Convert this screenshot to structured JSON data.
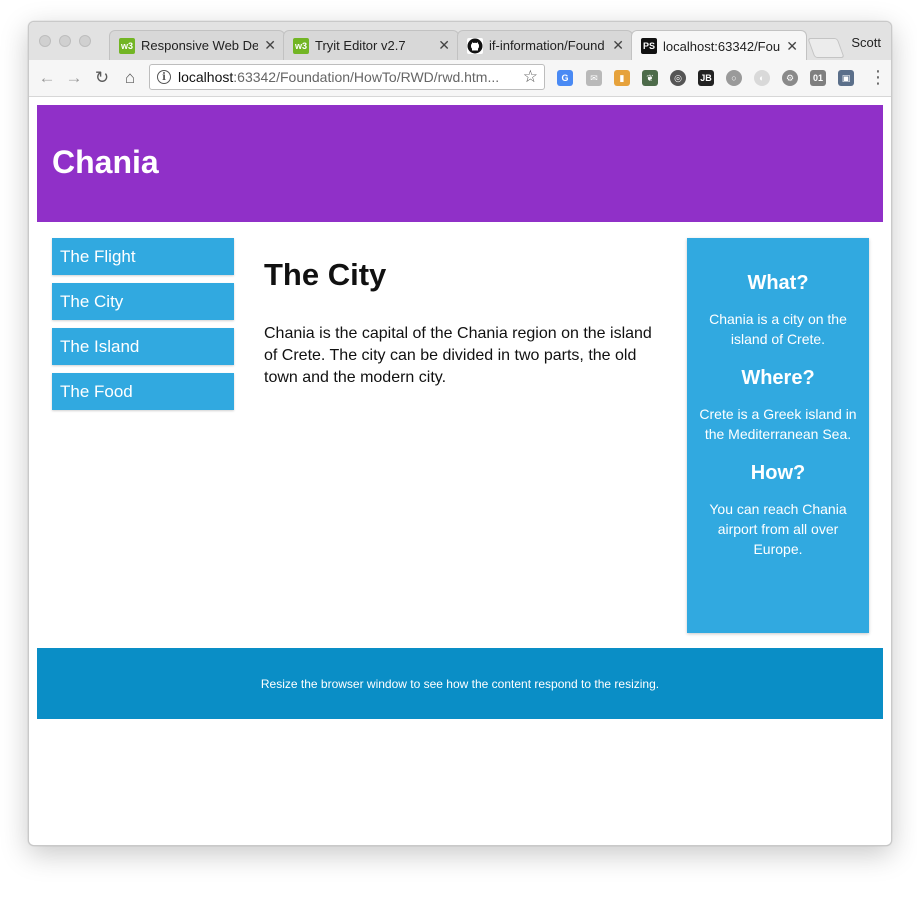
{
  "browser": {
    "tabs": [
      {
        "label": "Responsive Web Des",
        "favicon": "w3schools-icon"
      },
      {
        "label": "Tryit Editor v2.7",
        "favicon": "w3schools-icon"
      },
      {
        "label": "if-information/Found",
        "favicon": "github-icon"
      },
      {
        "label": "localhost:63342/Fou",
        "favicon": "phpstorm-icon"
      }
    ],
    "profile_name": "Scott",
    "url_host": "localhost",
    "url_path": ":63342/Foundation/HowTo/RWD/rwd.htm..."
  },
  "page": {
    "header_title": "Chania",
    "nav_items": [
      "The Flight",
      "The City",
      "The Island",
      "The Food"
    ],
    "main": {
      "title": "The City",
      "body": "Chania is the capital of the Chania region on the island of Crete. The city can be divided in two parts, the old town and the modern city."
    },
    "aside": [
      {
        "heading": "What?",
        "text": "Chania is a city on the island of Crete."
      },
      {
        "heading": "Where?",
        "text": "Crete is a Greek island in the Mediterranean Sea."
      },
      {
        "heading": "How?",
        "text": "You can reach Chania airport from all over Europe."
      }
    ],
    "footer_text": "Resize the browser window to see how the content respond to the resizing."
  },
  "colors": {
    "header_bg": "#9030c8",
    "nav_bg": "#31a9e0",
    "footer_bg": "#0a8ec6"
  }
}
